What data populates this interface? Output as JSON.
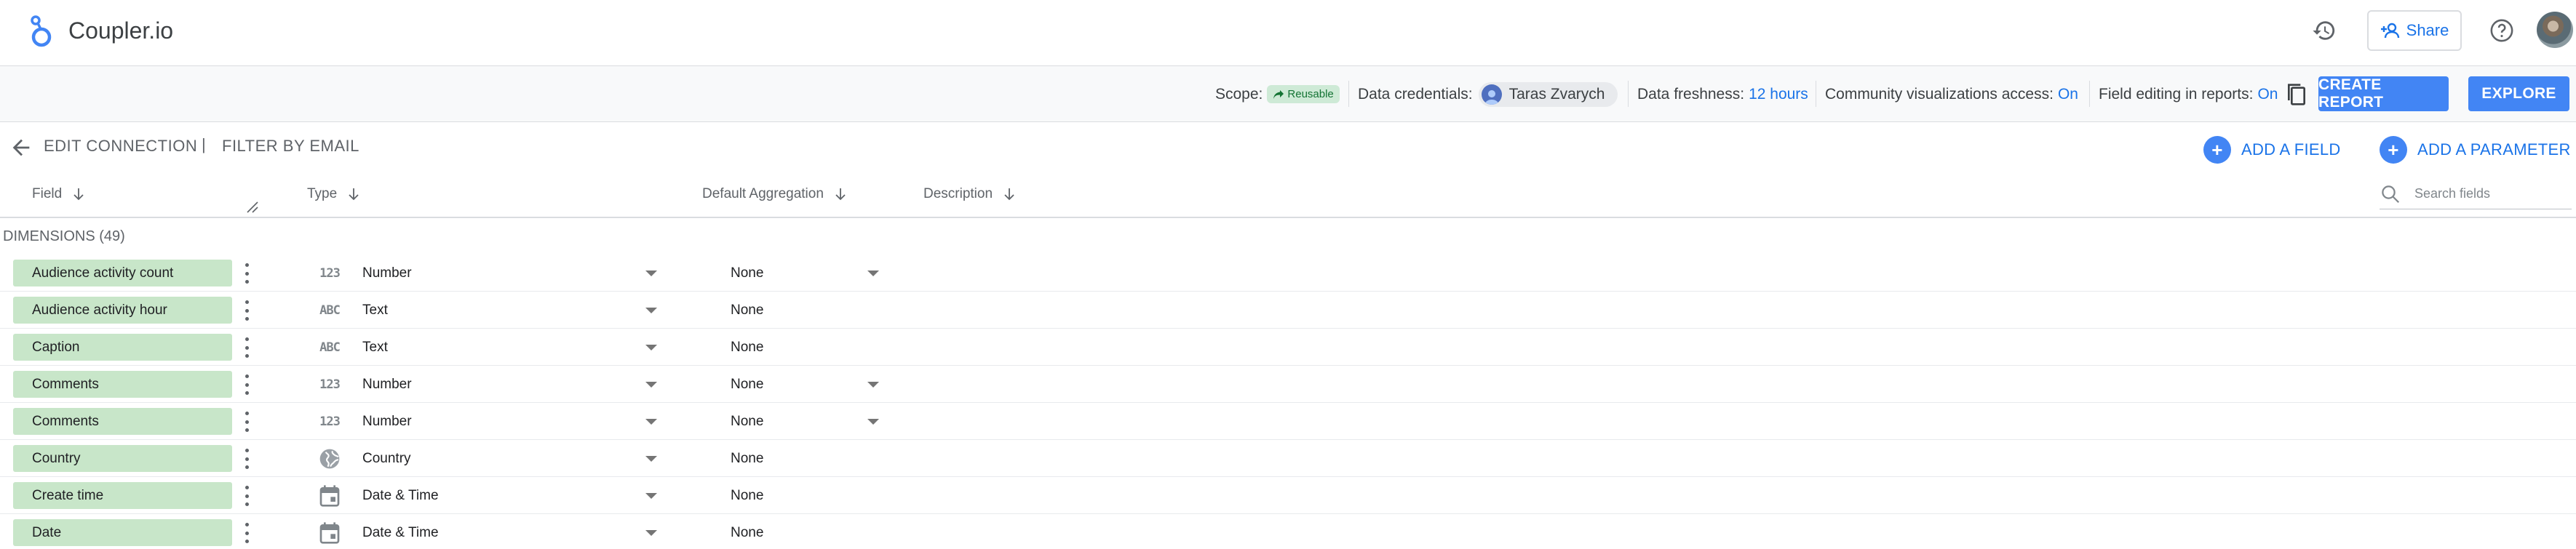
{
  "app": {
    "title": "Coupler.io"
  },
  "header_actions": {
    "share_label": "Share"
  },
  "toolbar": {
    "scope_label": "Scope:",
    "scope_chip": "Reusable",
    "credentials_label": "Data credentials:",
    "credentials_user": "Taras Zvarych",
    "freshness_label": "Data freshness:",
    "freshness_value": "12 hours",
    "community_label": "Community visualizations access:",
    "community_value": "On",
    "field_editing_label": "Field editing in reports:",
    "field_editing_value": "On",
    "create_report_label": "CREATE REPORT",
    "explore_label": "EXPLORE"
  },
  "connection": {
    "edit_label": "EDIT CONNECTION",
    "separator": "|",
    "name": "FILTER BY EMAIL",
    "add_field_label": "ADD A FIELD",
    "add_parameter_label": "ADD A PARAMETER"
  },
  "columns": {
    "field": "Field",
    "type": "Type",
    "aggregation": "Default Aggregation",
    "description": "Description",
    "search_placeholder": "Search fields"
  },
  "section": {
    "dimensions_label": "DIMENSIONS (49)"
  },
  "fields": [
    {
      "name": "Audience activity count",
      "type_icon": "number-icon",
      "type_glyph": "123",
      "type": "Number",
      "aggregation": "None",
      "agg_dropdown": true
    },
    {
      "name": "Audience activity hour",
      "type_icon": "text-icon",
      "type_glyph": "ABC",
      "type": "Text",
      "aggregation": "None",
      "agg_dropdown": false
    },
    {
      "name": "Caption",
      "type_icon": "text-icon",
      "type_glyph": "ABC",
      "type": "Text",
      "aggregation": "None",
      "agg_dropdown": false
    },
    {
      "name": "Comments",
      "type_icon": "number-icon",
      "type_glyph": "123",
      "type": "Number",
      "aggregation": "None",
      "agg_dropdown": true
    },
    {
      "name": "Comments",
      "type_icon": "number-icon",
      "type_glyph": "123",
      "type": "Number",
      "aggregation": "None",
      "agg_dropdown": true
    },
    {
      "name": "Country",
      "type_icon": "globe-icon",
      "type_glyph": "",
      "type": "Country",
      "aggregation": "None",
      "agg_dropdown": false
    },
    {
      "name": "Create time",
      "type_icon": "calendar-icon",
      "type_glyph": "",
      "type": "Date & Time",
      "aggregation": "None",
      "agg_dropdown": false
    },
    {
      "name": "Date",
      "type_icon": "calendar-icon",
      "type_glyph": "",
      "type": "Date & Time",
      "aggregation": "None",
      "agg_dropdown": false
    }
  ],
  "colors": {
    "accent": "#1a73e8",
    "primary_button": "#4285f4",
    "dimension_chip": "#c8e6c9",
    "reusable_chip": "#ceead6"
  }
}
